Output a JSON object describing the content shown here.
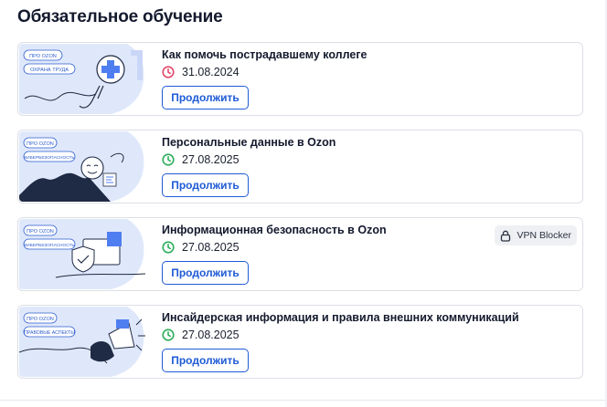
{
  "section": {
    "title": "Обязательное обучение"
  },
  "courses": [
    {
      "title": "Как помочь пострадавшему коллеге",
      "date": "31.08.2024",
      "status": "overdue",
      "status_color": "#e5486b",
      "button": "Продолжить",
      "thumb_tag": "ПРО OZON",
      "thumb_subtitle": "ОХРАНА ТРУДА",
      "thumb_icon": "first-aid-hand-icon"
    },
    {
      "title": "Персональные данные в Ozon",
      "date": "27.08.2025",
      "status": "active",
      "status_color": "#2fae5b",
      "button": "Продолжить",
      "thumb_tag": "ПРО OZON",
      "thumb_subtitle": "КИБЕРБЕЗОПАСНОСТЬ",
      "thumb_icon": "person-data-icon"
    },
    {
      "title": "Информационная безопасность в Ozon",
      "date": "27.08.2025",
      "status": "active",
      "status_color": "#2fae5b",
      "button": "Продолжить",
      "thumb_tag": "ПРО OZON",
      "thumb_subtitle": "КИБЕРБЕЗОПАСНОСТЬ",
      "thumb_icon": "security-shield-icon",
      "badge": {
        "label": "VPN Blocker",
        "icon": "lock-icon"
      }
    },
    {
      "title": "Инсайдерская информация и правила внешних коммуникаций",
      "date": "27.08.2025",
      "status": "active",
      "status_color": "#2fae5b",
      "button": "Продолжить",
      "thumb_tag": "ПРО OZON",
      "thumb_subtitle": "ПРАВОВЫЕ АСПЕКТЫ",
      "thumb_icon": "megaphone-icon"
    }
  ],
  "colors": {
    "accent": "#1f5bd6",
    "card_border": "#dcdfe6",
    "thumb_bg": "#dfe8fb"
  }
}
